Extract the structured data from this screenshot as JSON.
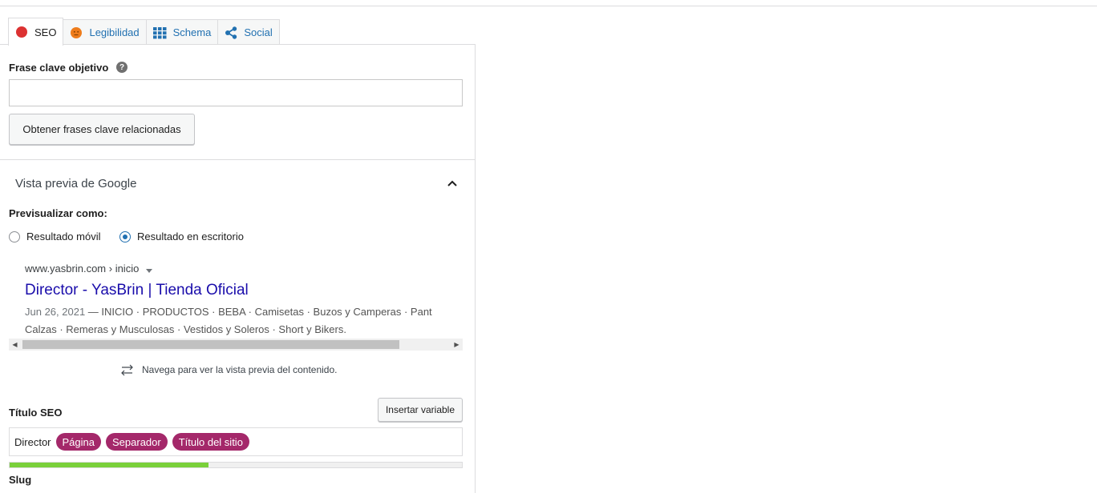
{
  "tabs": [
    {
      "label": "SEO",
      "icon": "red-dot-icon",
      "color": "#dc3232"
    },
    {
      "label": "Legibilidad",
      "icon": "orange-face-icon",
      "color": "#ee7c1b"
    },
    {
      "label": "Schema",
      "icon": "grid-icon",
      "color": "#2271b1"
    },
    {
      "label": "Social",
      "icon": "share-icon",
      "color": "#2271b1"
    }
  ],
  "keyphrase": {
    "label": "Frase clave objetivo",
    "help": "?",
    "value": "",
    "related_button": "Obtener frases clave relacionadas"
  },
  "google_preview": {
    "title": "Vista previa de Google",
    "preview_as_label": "Previsualizar como:",
    "options": [
      "Resultado móvil",
      "Resultado en escritorio"
    ],
    "selected": "Resultado en escritorio",
    "url": "www.yasbrin.com › inicio",
    "result_title": "Director - YasBrin | Tienda Oficial",
    "date": "Jun 26, 2021",
    "desc_line1": " — INICIO · PRODUCTOS · BEBA · Camisetas · Buzos y Camperas · Pant",
    "desc_line2": "Calzas · Remeras y Musculosas · Vestidos y Soleros · Short y Bikers.",
    "nav_hint": "Navega para ver la vista previa del contenido."
  },
  "seo_title": {
    "label": "Título SEO",
    "insert_button": "Insertar variable",
    "prefix": "Director",
    "chips": [
      "Página",
      "Separador",
      "Título del sitio"
    ],
    "progress_fraction": 0.44,
    "progress_color": "#7ad03a",
    "chip_color": "#a4286a"
  },
  "slug": {
    "label": "Slug"
  }
}
